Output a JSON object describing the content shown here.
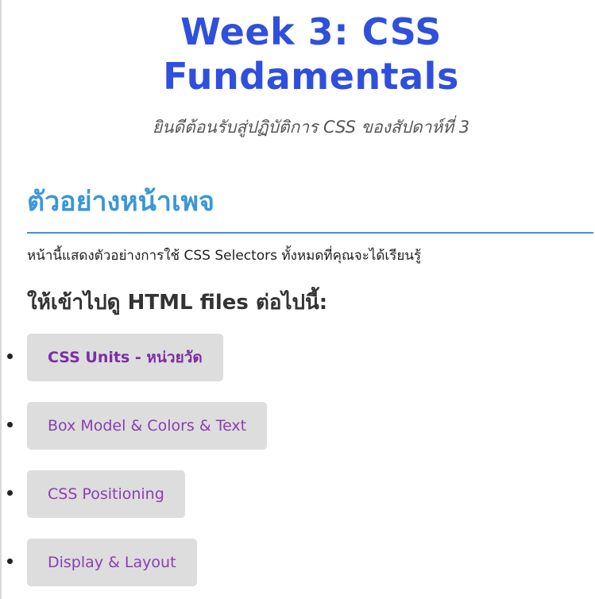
{
  "header": {
    "title": "Week 3: CSS Fundamentals",
    "subtitle": "ยินดีต้อนรับสู่ปฏิบัติการ CSS ของสัปดาห์ที่ 3"
  },
  "section": {
    "title": "ตัวอย่างหน้าเพจ",
    "intro": "หน้านี้แสดงตัวอย่างการใช้ CSS Selectors ทั้งหมดที่คุณจะได้เรียนรู้",
    "subheading": "ให้เข้าไปดู HTML files ต่อไปนี้:"
  },
  "links": [
    {
      "label": "CSS Units - หน่วยวัด",
      "active": true
    },
    {
      "label": "Box Model & Colors & Text",
      "active": false
    },
    {
      "label": "CSS Positioning",
      "active": false
    },
    {
      "label": "Display & Layout",
      "active": false
    }
  ],
  "colors": {
    "title": "#2f4fdc",
    "section_accent": "#3a97d6",
    "link_text": "#8a3fb0",
    "button_bg": "#dddddd"
  }
}
